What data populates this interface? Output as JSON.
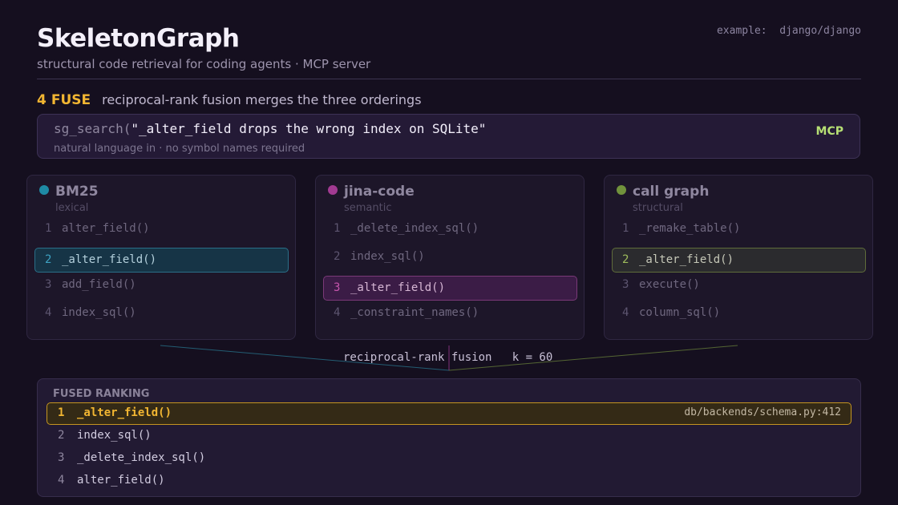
{
  "header": {
    "title": "SkeletonGraph",
    "subtitle": "structural code retrieval for coding agents  ·  MCP server",
    "example": "example:  django/django"
  },
  "step": {
    "number": "4",
    "name": "FUSE",
    "description": "reciprocal-rank fusion merges the three orderings"
  },
  "query": {
    "function": "sg_search(",
    "text": "\"_alter_field drops the wrong index on SQLite\"",
    "caption": "natural language in  ·  no symbol names required",
    "badge": "MCP"
  },
  "retrievers": [
    {
      "name": "BM25",
      "type": "lexical",
      "color": "#1e8aa4",
      "highlight_rank": 2,
      "results": [
        {
          "rank": "1",
          "symbol": "alter_field()"
        },
        {
          "rank": "2",
          "symbol": "_alter_field()"
        },
        {
          "rank": "3",
          "symbol": "add_field()"
        },
        {
          "rank": "4",
          "symbol": "index_sql()"
        }
      ]
    },
    {
      "name": "jina-code",
      "type": "semantic",
      "color": "#a23a92",
      "highlight_rank": 3,
      "results": [
        {
          "rank": "1",
          "symbol": "_delete_index_sql()"
        },
        {
          "rank": "2",
          "symbol": "index_sql()"
        },
        {
          "rank": "3",
          "symbol": "_alter_field()"
        },
        {
          "rank": "4",
          "symbol": "_constraint_names()"
        }
      ]
    },
    {
      "name": "call graph",
      "type": "structural",
      "color": "#71923c",
      "highlight_rank": 2,
      "results": [
        {
          "rank": "1",
          "symbol": "_remake_table()"
        },
        {
          "rank": "2",
          "symbol": "_alter_field()"
        },
        {
          "rank": "3",
          "symbol": "execute()"
        },
        {
          "rank": "4",
          "symbol": "column_sql()"
        }
      ]
    }
  ],
  "fusion": {
    "label": "reciprocal-rank fusion   k = 60"
  },
  "fused": {
    "heading": "FUSED RANKING",
    "accent": "#f2b632",
    "results": [
      {
        "rank": "1",
        "symbol": "_alter_field()",
        "location": "db/backends/schema.py:412"
      },
      {
        "rank": "2",
        "symbol": "index_sql()"
      },
      {
        "rank": "3",
        "symbol": "_delete_index_sql()"
      },
      {
        "rank": "4",
        "symbol": "alter_field()"
      }
    ]
  }
}
